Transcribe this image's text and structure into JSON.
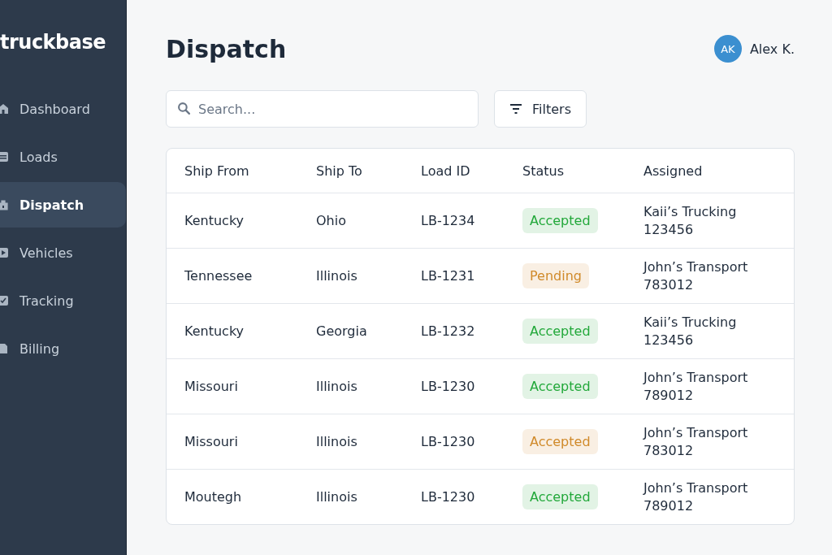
{
  "sidebar": {
    "logo": "truckbase",
    "items": [
      {
        "label": "Dashboard",
        "selected": false
      },
      {
        "label": "Loads",
        "selected": false
      },
      {
        "label": "Dispatch",
        "selected": true
      },
      {
        "label": "Vehicles",
        "selected": false
      },
      {
        "label": "Tracking",
        "selected": false
      },
      {
        "label": "Billing",
        "selected": false
      }
    ]
  },
  "header": {
    "title": "Dispatch",
    "user": {
      "initials": "AK",
      "name": "Alex K."
    }
  },
  "search": {
    "placeholder": "Search..."
  },
  "filters_button": "Filters",
  "table": {
    "columns": [
      "Ship From",
      "Ship To",
      "Load ID",
      "Status",
      "Assigned"
    ],
    "rows": [
      {
        "from": "Kentucky",
        "to": "Ohio",
        "load_id": "LB-1234",
        "status": {
          "label": "Accepted",
          "color": "#22a83a"
        },
        "assigned": [
          "Kaii’s Trucking",
          "123456"
        ]
      },
      {
        "from": "Tennessee",
        "to": "Illinois",
        "load_id": "LB-1231",
        "status": {
          "label": "Pending",
          "color": "#d08a2a"
        },
        "assigned": [
          "John’s Transport",
          "783012"
        ]
      },
      {
        "from": "Kentucky",
        "to": "Georgia",
        "load_id": "LB-1232",
        "status": {
          "label": "Accepted",
          "color": "#22a83a"
        },
        "assigned": [
          "Kaii’s Trucking",
          "123456"
        ]
      },
      {
        "from": "Missouri",
        "to": "Illinois",
        "load_id": "LB-1230",
        "status": {
          "label": "Accepted",
          "color": "#22a83a"
        },
        "assigned": [
          "John’s Transport",
          "789012"
        ]
      },
      {
        "from": "Missouri",
        "to": "Illinois",
        "load_id": "LB-1230",
        "status": {
          "label": "Accepted",
          "color": "#d08a2a"
        },
        "assigned": [
          "John’s Transport",
          "783012"
        ]
      },
      {
        "from": "Moutegh",
        "to": "Illinois",
        "load_id": "LB-1230",
        "status": {
          "label": "Accepted",
          "color": "#22a83a"
        },
        "assigned": [
          "John’s Transport",
          "789012"
        ]
      }
    ]
  }
}
